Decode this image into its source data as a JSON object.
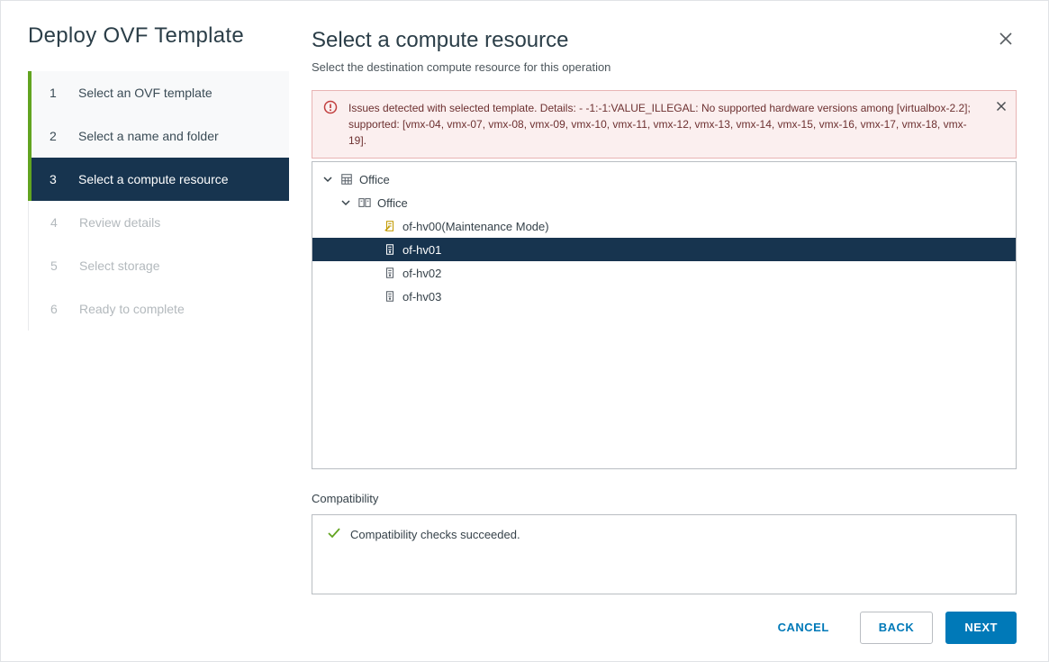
{
  "wizard": {
    "title": "Deploy OVF Template",
    "steps": [
      {
        "num": "1",
        "label": "Select an OVF template",
        "state": "completed"
      },
      {
        "num": "2",
        "label": "Select a name and folder",
        "state": "completed"
      },
      {
        "num": "3",
        "label": "Select a compute resource",
        "state": "active"
      },
      {
        "num": "4",
        "label": "Review details",
        "state": "disabled"
      },
      {
        "num": "5",
        "label": "Select storage",
        "state": "disabled"
      },
      {
        "num": "6",
        "label": "Ready to complete",
        "state": "disabled"
      }
    ]
  },
  "main": {
    "title": "Select a compute resource",
    "subtitle": "Select the destination compute resource for this operation"
  },
  "alert": {
    "text": "Issues detected with selected template. Details: - -1:-1:VALUE_ILLEGAL: No supported hardware versions among [virtualbox-2.2]; supported: [vmx-04, vmx-07, vmx-08, vmx-09, vmx-10, vmx-11, vmx-12, vmx-13, vmx-14, vmx-15, vmx-16, vmx-17, vmx-18, vmx-19]."
  },
  "tree": {
    "dc": "Office",
    "cluster": "Office",
    "hosts": [
      {
        "name": "of-hv00(Maintenance Mode)",
        "icon": "host-maint",
        "selected": false
      },
      {
        "name": "of-hv01",
        "icon": "host",
        "selected": true
      },
      {
        "name": "of-hv02",
        "icon": "host",
        "selected": false
      },
      {
        "name": "of-hv03",
        "icon": "host",
        "selected": false
      }
    ]
  },
  "compat": {
    "label": "Compatibility",
    "message": "Compatibility checks succeeded."
  },
  "footer": {
    "cancel": "CANCEL",
    "back": "BACK",
    "next": "NEXT"
  }
}
